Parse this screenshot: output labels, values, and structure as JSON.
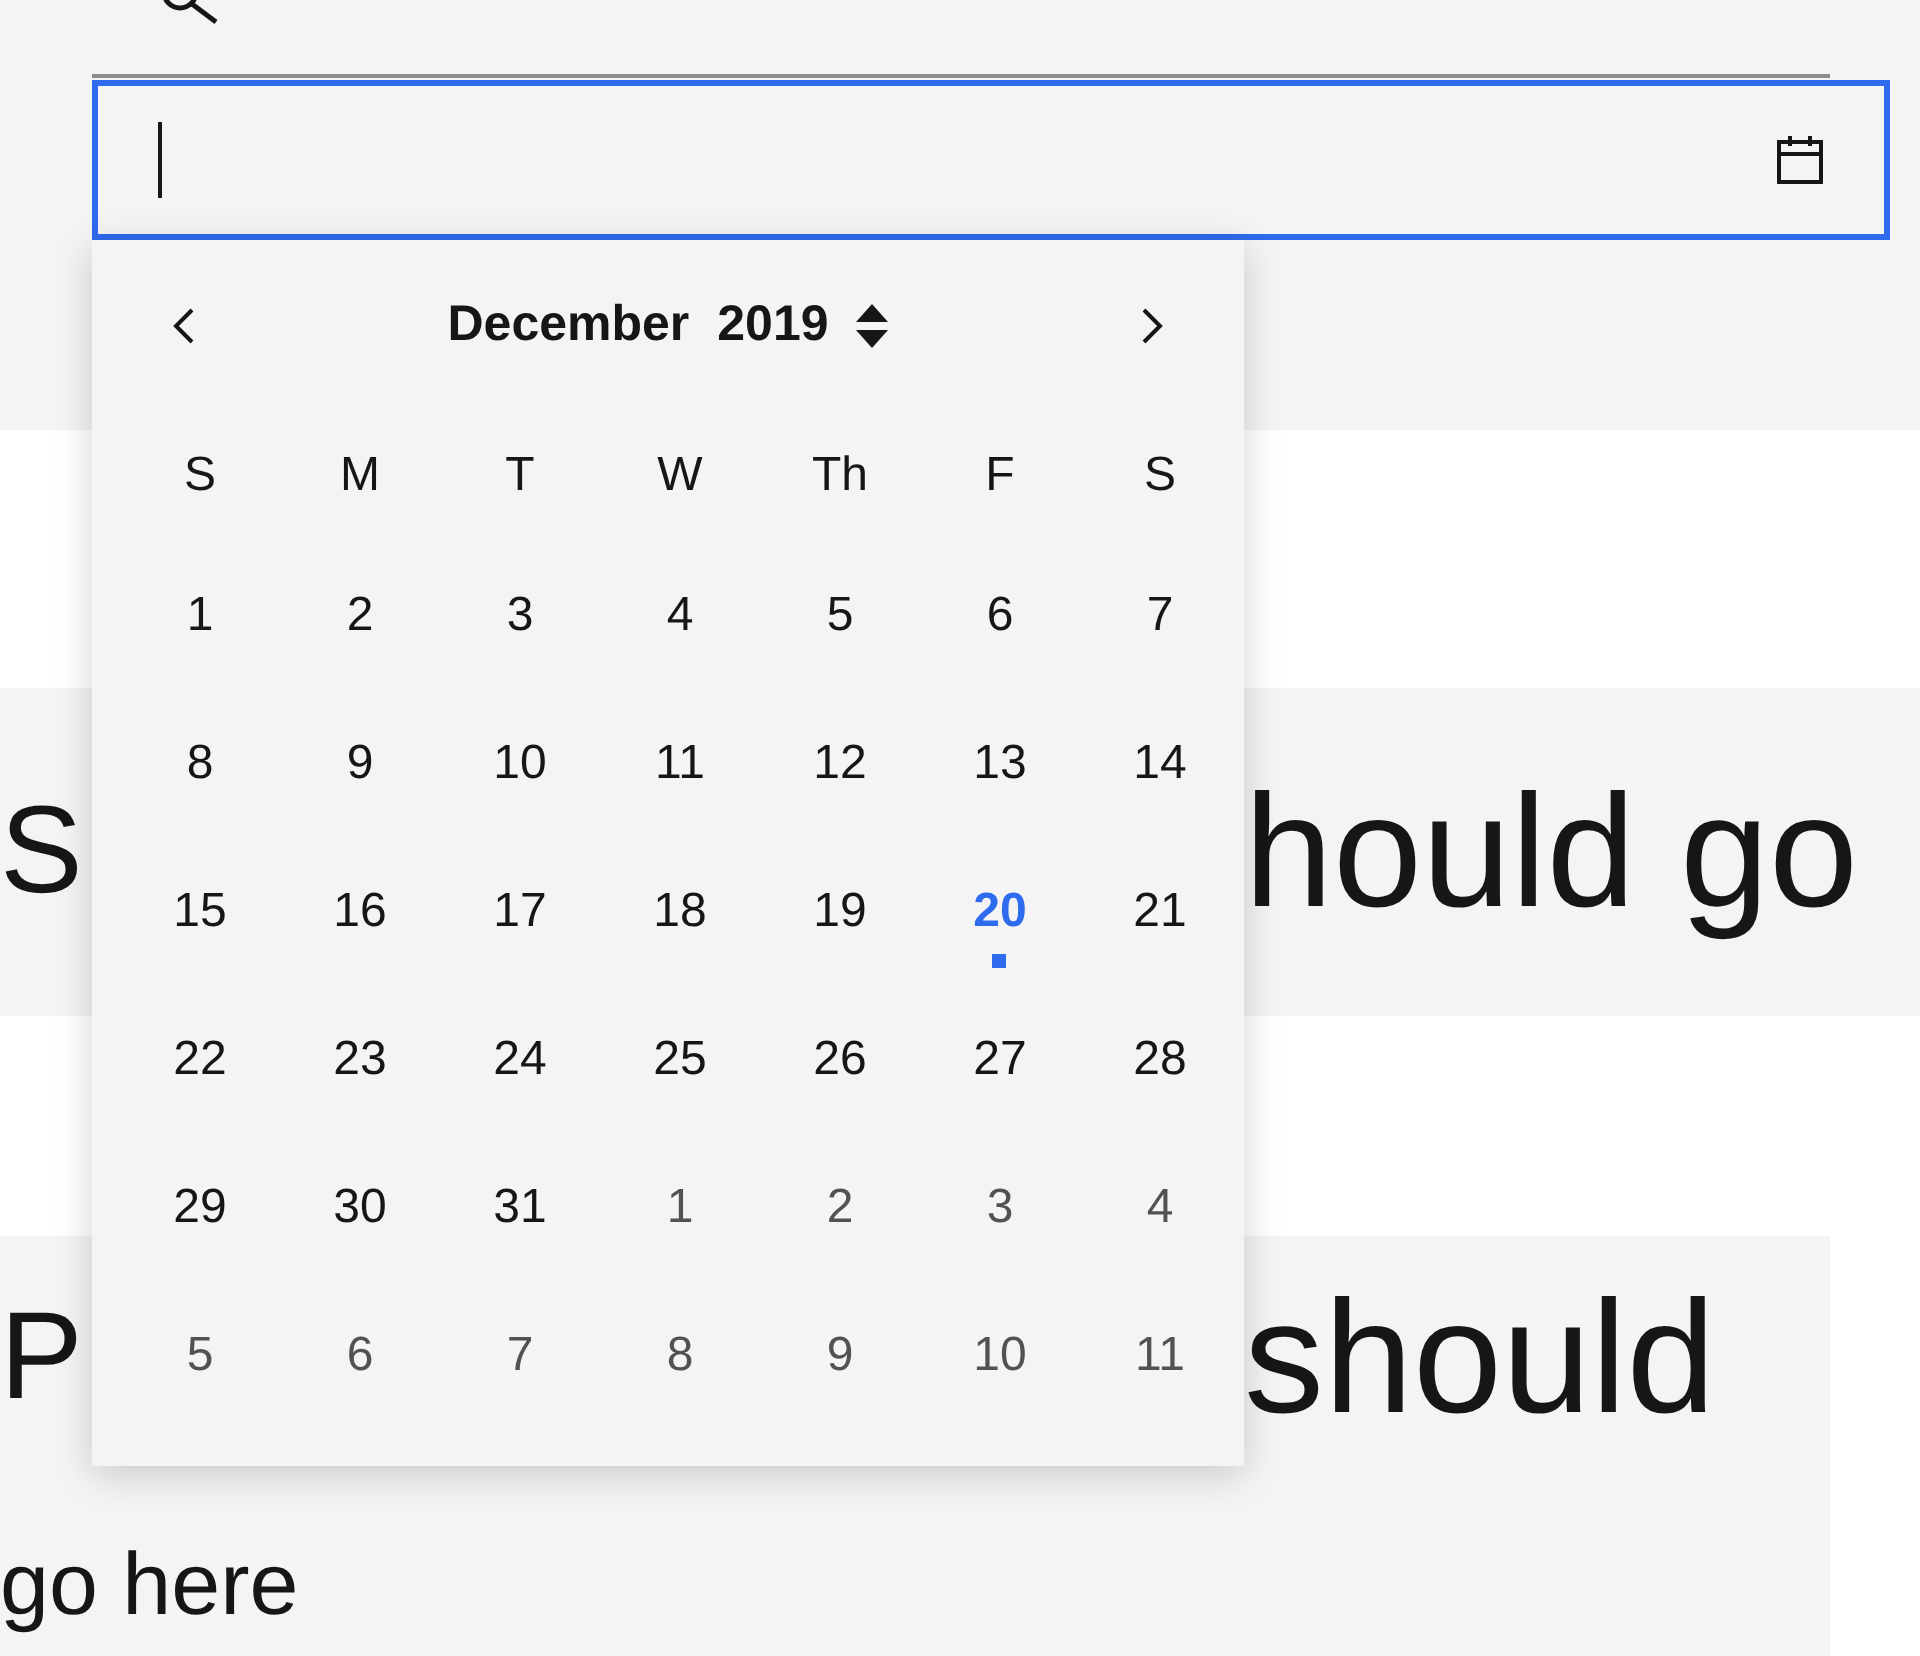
{
  "date_field": {
    "focused": true
  },
  "calendar": {
    "month": "December",
    "year": "2019",
    "weekdays": [
      "S",
      "M",
      "T",
      "W",
      "Th",
      "F",
      "S"
    ],
    "weeks": [
      [
        {
          "day": "1",
          "outside": false,
          "today": false
        },
        {
          "day": "2",
          "outside": false,
          "today": false
        },
        {
          "day": "3",
          "outside": false,
          "today": false
        },
        {
          "day": "4",
          "outside": false,
          "today": false
        },
        {
          "day": "5",
          "outside": false,
          "today": false
        },
        {
          "day": "6",
          "outside": false,
          "today": false
        },
        {
          "day": "7",
          "outside": false,
          "today": false
        }
      ],
      [
        {
          "day": "8",
          "outside": false,
          "today": false
        },
        {
          "day": "9",
          "outside": false,
          "today": false
        },
        {
          "day": "10",
          "outside": false,
          "today": false
        },
        {
          "day": "11",
          "outside": false,
          "today": false
        },
        {
          "day": "12",
          "outside": false,
          "today": false
        },
        {
          "day": "13",
          "outside": false,
          "today": false
        },
        {
          "day": "14",
          "outside": false,
          "today": false
        }
      ],
      [
        {
          "day": "15",
          "outside": false,
          "today": false
        },
        {
          "day": "16",
          "outside": false,
          "today": false
        },
        {
          "day": "17",
          "outside": false,
          "today": false
        },
        {
          "day": "18",
          "outside": false,
          "today": false
        },
        {
          "day": "19",
          "outside": false,
          "today": false
        },
        {
          "day": "20",
          "outside": false,
          "today": true
        },
        {
          "day": "21",
          "outside": false,
          "today": false
        }
      ],
      [
        {
          "day": "22",
          "outside": false,
          "today": false
        },
        {
          "day": "23",
          "outside": false,
          "today": false
        },
        {
          "day": "24",
          "outside": false,
          "today": false
        },
        {
          "day": "25",
          "outside": false,
          "today": false
        },
        {
          "day": "26",
          "outside": false,
          "today": false
        },
        {
          "day": "27",
          "outside": false,
          "today": false
        },
        {
          "day": "28",
          "outside": false,
          "today": false
        }
      ],
      [
        {
          "day": "29",
          "outside": false,
          "today": false
        },
        {
          "day": "30",
          "outside": false,
          "today": false
        },
        {
          "day": "31",
          "outside": false,
          "today": false
        },
        {
          "day": "1",
          "outside": true,
          "today": false
        },
        {
          "day": "2",
          "outside": true,
          "today": false
        },
        {
          "day": "3",
          "outside": true,
          "today": false
        },
        {
          "day": "4",
          "outside": true,
          "today": false
        }
      ],
      [
        {
          "day": "5",
          "outside": true,
          "today": false
        },
        {
          "day": "6",
          "outside": true,
          "today": false
        },
        {
          "day": "7",
          "outside": true,
          "today": false
        },
        {
          "day": "8",
          "outside": true,
          "today": false
        },
        {
          "day": "9",
          "outside": true,
          "today": false
        },
        {
          "day": "10",
          "outside": true,
          "today": false
        },
        {
          "day": "11",
          "outside": true,
          "today": false
        }
      ]
    ]
  },
  "background_panels": [
    {
      "left": "S",
      "right": "hould go"
    },
    {
      "left": "P",
      "right": "should",
      "next_line": "go here"
    }
  ]
}
